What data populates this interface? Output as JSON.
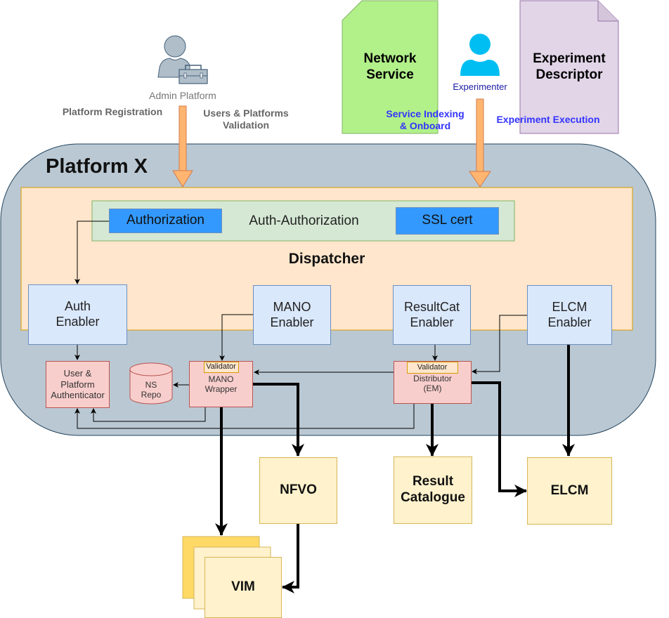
{
  "actors": {
    "admin": {
      "label": "Admin Platform",
      "icon": "admin-user-toolbox-icon"
    },
    "experimenter": {
      "label": "Experimenter",
      "icon": "user-icon"
    }
  },
  "documents": {
    "network_service": {
      "line1": "Network",
      "line2": "Service",
      "color": "#b2f08a"
    },
    "experiment_descriptor": {
      "line1": "Experiment",
      "line2": "Descriptor",
      "color": "#e1d5e7"
    }
  },
  "flow_labels": {
    "platform_registration": "Platform Registration",
    "users_platforms_validation_1": "Users & Platforms",
    "users_platforms_validation_2": "Validation",
    "service_indexing_1": "Service Indexing",
    "service_indexing_2": "& Onboard",
    "experiment_execution": "Experiment Execution"
  },
  "platform": {
    "title": "Platform X",
    "color": "#bac8d3",
    "dispatcher": {
      "title": "Dispatcher",
      "auth_group": {
        "label": "Auth-Authorization",
        "authorization": "Authorization",
        "ssl_cert": "SSL cert"
      },
      "enablers": [
        {
          "line1": "Auth",
          "line2": "Enabler"
        },
        {
          "line1": "MANO",
          "line2": "Enabler"
        },
        {
          "line1": "ResultCat",
          "line2": "Enabler"
        },
        {
          "line1": "ELCM",
          "line2": "Enabler"
        }
      ]
    },
    "components": {
      "authenticator": {
        "line1": "User &",
        "line2": "Platform",
        "line3": "Authenticator"
      },
      "ns_repo": {
        "line1": "NS",
        "line2": "Repo"
      },
      "mano_wrapper": {
        "validator": "Validator",
        "line1": "MANO",
        "line2": "Wrapper"
      },
      "distributor": {
        "validator": "Validator",
        "line1": "Distributor",
        "line2": "(EM)"
      }
    }
  },
  "external": {
    "nfvo": "NFVO",
    "result_catalogue_1": "Result",
    "result_catalogue_2": "Catalogue",
    "elcm": "ELCM",
    "vim": "VIM"
  },
  "colors": {
    "arrow_orange": "#ffb570",
    "dispatcher_bg": "#ffe6cc",
    "auth_group_bg": "#d5e8d4",
    "blue_button": "#3399ff",
    "experimenter_icon": "#00bef2"
  }
}
